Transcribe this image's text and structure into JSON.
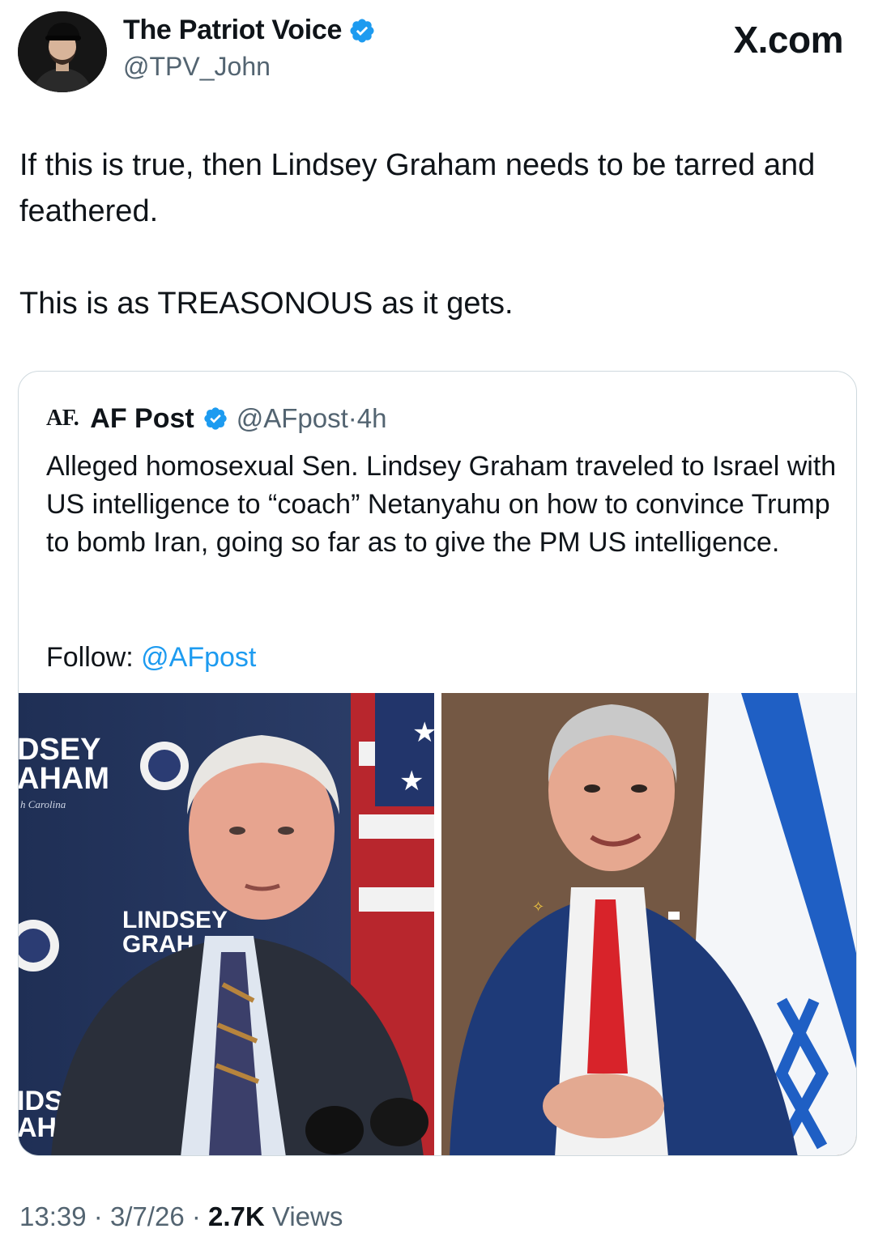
{
  "post": {
    "author": {
      "display_name": "The Patriot Voice",
      "handle": "@TPV_John",
      "verified": true,
      "avatar_icon": "profile-photo"
    },
    "brand_label": "X.com",
    "text_paragraphs": [
      "If this is true, then Lindsey Graham needs to be tarred and feathered.",
      "This is as TREASONOUS as it gets."
    ],
    "time": "13:39",
    "date": "3/7/26",
    "views_count": "2.7K",
    "views_label": "Views",
    "separator": "·"
  },
  "quoted_post": {
    "logo_text": "AF.",
    "display_name": "AF Post",
    "verified": true,
    "handle_time": "@AFpost·4h",
    "text": "Alleged homosexual Sen. Lindsey Graham traveled to Israel with US intelligence to “coach” Netanyahu on how to convince Trump to bomb Iran, going so far as to give the PM US intelligence.",
    "follow_label": "Follow: ",
    "follow_mention": "@AFpost",
    "media": [
      {
        "icon": "photo-senator-at-podium",
        "backdrop_text": [
          "DSEY",
          "AHAM",
          "h Carolina",
          "LINDSEY",
          "GRAH",
          "IDS",
          "AH"
        ]
      },
      {
        "icon": "photo-leader-with-flag"
      }
    ]
  },
  "colors": {
    "accent": "#1d9bf0",
    "text_primary": "#0f1419",
    "text_secondary": "#536471",
    "border": "#cfd9de"
  }
}
